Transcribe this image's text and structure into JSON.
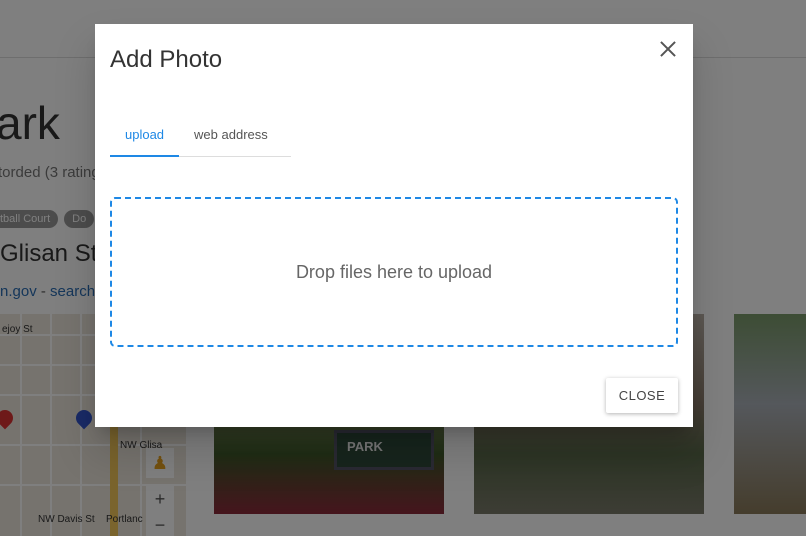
{
  "background": {
    "title": "ark",
    "rating_text": "torded (3 rating",
    "tags": [
      "tball Court",
      "Do"
    ],
    "address": "Glisan St",
    "links": {
      "site": "n.gov",
      "separator": " - ",
      "search": "search"
    },
    "map": {
      "streets": [
        "ejoy St",
        "NW Glisa",
        "NW Davis St",
        "Portlanc"
      ],
      "zoom_in": "+",
      "zoom_out": "−"
    },
    "photo_sign_text": "PARK"
  },
  "dialog": {
    "title": "Add Photo",
    "tabs": [
      {
        "label": "upload",
        "active": true
      },
      {
        "label": "web address",
        "active": false
      }
    ],
    "dropzone_text": "Drop files here to upload",
    "close_button_label": "CLOSE"
  },
  "colors": {
    "accent": "#1e88e5",
    "overlay": "rgba(0,0,0,0.5)"
  }
}
